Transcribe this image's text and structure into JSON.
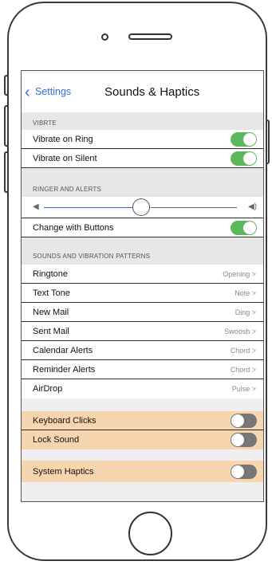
{
  "nav": {
    "back_label": "Settings",
    "title": "Sounds & Haptics"
  },
  "vibrate_section": {
    "header": "VIBRTE",
    "rows": [
      {
        "label": "Vibrate on Ring",
        "on": true
      },
      {
        "label": "Vibrate on Silent",
        "on": true
      }
    ]
  },
  "ringer_section": {
    "header": "RINGER AND ALERTS",
    "volume_level": 0.47,
    "change_with_buttons": {
      "label": "Change with Buttons",
      "on": true
    }
  },
  "sounds_section": {
    "header": "SOUNDS AND VIBRATION PATTERNS",
    "rows": [
      {
        "label": "Ringtone",
        "value": "Opening >"
      },
      {
        "label": "Text Tone",
        "value": "Note >"
      },
      {
        "label": "New Mail",
        "value": "Ding >"
      },
      {
        "label": "Sent Mail",
        "value": "Swoosh >"
      },
      {
        "label": "Calendar Alerts",
        "value": "Chord >"
      },
      {
        "label": "Reminder Alerts",
        "value": "Chord >"
      },
      {
        "label": "AirDrop",
        "value": "Pulse >"
      }
    ]
  },
  "other_toggles": [
    {
      "label": "Keyboard Clicks",
      "on": false
    },
    {
      "label": "Lock Sound",
      "on": false
    }
  ],
  "haptics": {
    "label": "System Haptics",
    "on": false
  },
  "colors": {
    "accent": "#2e6fe0",
    "toggle_on": "#5cb85c",
    "toggle_off": "#777777",
    "highlight": "#f7d5ae"
  }
}
